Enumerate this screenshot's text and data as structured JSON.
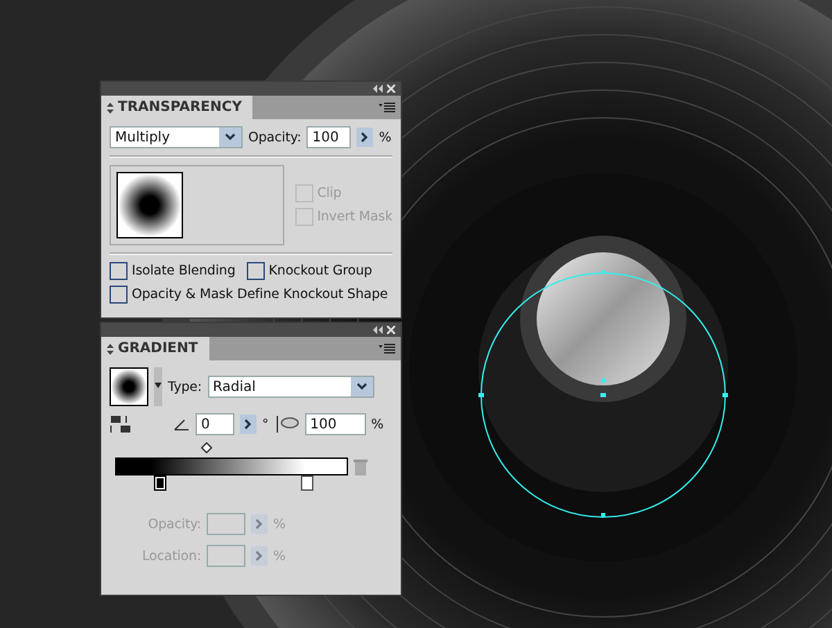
{
  "transparency": {
    "title": "TRANSPARENCY",
    "blend_mode": "Multiply",
    "opacity_label": "Opacity:",
    "opacity_value": "100",
    "percent": "%",
    "mask_options": [
      {
        "label": "Clip",
        "checked": false,
        "disabled": true
      },
      {
        "label": "Invert Mask",
        "checked": false,
        "disabled": true
      }
    ],
    "options": [
      {
        "label": "Isolate Blending",
        "checked": false
      },
      {
        "label": "Knockout Group",
        "checked": false
      },
      {
        "label": "Opacity & Mask Define Knockout Shape",
        "checked": false
      }
    ]
  },
  "gradient": {
    "title": "GRADIENT",
    "type_label": "Type:",
    "type_value": "Radial",
    "angle_value": "0",
    "degree": "°",
    "aspect_value": "100",
    "percent": "%",
    "stops": [
      {
        "color": "#000000",
        "selected": true
      },
      {
        "color": "#ffffff",
        "selected": false
      }
    ],
    "disabled_fields": [
      {
        "label": "Opacity:",
        "percent": "%"
      },
      {
        "label": "Location:",
        "percent": "%"
      }
    ]
  }
}
